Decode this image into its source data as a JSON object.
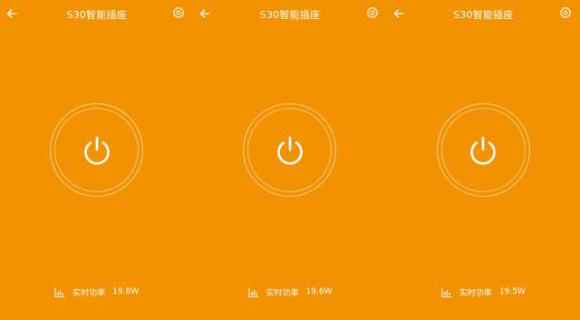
{
  "screens": [
    {
      "title": "S30智能插座",
      "power_label": "实时功率",
      "power_value": "19.8W",
      "icons": {
        "back": "back-arrow-icon",
        "settings": "gear-icon",
        "power": "power-icon",
        "chart": "bar-chart-icon"
      }
    },
    {
      "title": "S30智能插座",
      "power_label": "实时功率",
      "power_value": "19.6W",
      "icons": {
        "back": "back-arrow-icon",
        "settings": "gear-icon",
        "power": "power-icon",
        "chart": "bar-chart-icon"
      }
    },
    {
      "title": "S30智能插座",
      "power_label": "实时功率",
      "power_value": "19.5W",
      "icons": {
        "back": "back-arrow-icon",
        "settings": "gear-icon",
        "power": "power-icon",
        "chart": "bar-chart-icon"
      }
    }
  ],
  "colors": {
    "background": "#F29200",
    "foreground": "#FFFFFF"
  }
}
